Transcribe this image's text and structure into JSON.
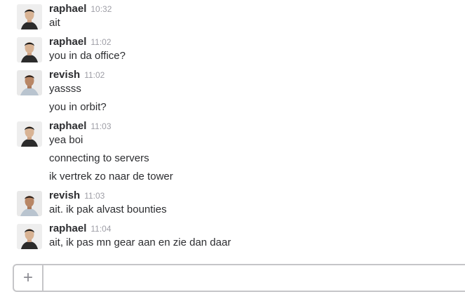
{
  "messages": [
    {
      "sender": "raphael",
      "time": "10:32",
      "avatar_icon": "person-avatar-raphael",
      "lines": [
        "ait"
      ]
    },
    {
      "sender": "raphael",
      "time": "11:02",
      "avatar_icon": "person-avatar-raphael",
      "lines": [
        "you in da office?"
      ]
    },
    {
      "sender": "revish",
      "time": "11:02",
      "avatar_icon": "person-avatar-revish",
      "lines": [
        "yassss",
        "you in orbit?"
      ]
    },
    {
      "sender": "raphael",
      "time": "11:03",
      "avatar_icon": "person-avatar-raphael",
      "lines": [
        "yea boi",
        "connecting to servers",
        "ik vertrek zo naar de tower"
      ]
    },
    {
      "sender": "revish",
      "time": "11:03",
      "avatar_icon": "person-avatar-revish",
      "lines": [
        "ait. ik pak alvast bounties"
      ]
    },
    {
      "sender": "raphael",
      "time": "11:04",
      "avatar_icon": "person-avatar-raphael",
      "lines": [
        "ait, ik pas mn gear aan en zie dan daar"
      ]
    }
  ],
  "composer": {
    "plus_icon": "plus-icon",
    "plus_glyph": "+",
    "input_value": "",
    "placeholder": ""
  },
  "colors": {
    "text": "#2c2d30",
    "timestamp": "#9e9ea6",
    "border": "#c5c5c8"
  }
}
